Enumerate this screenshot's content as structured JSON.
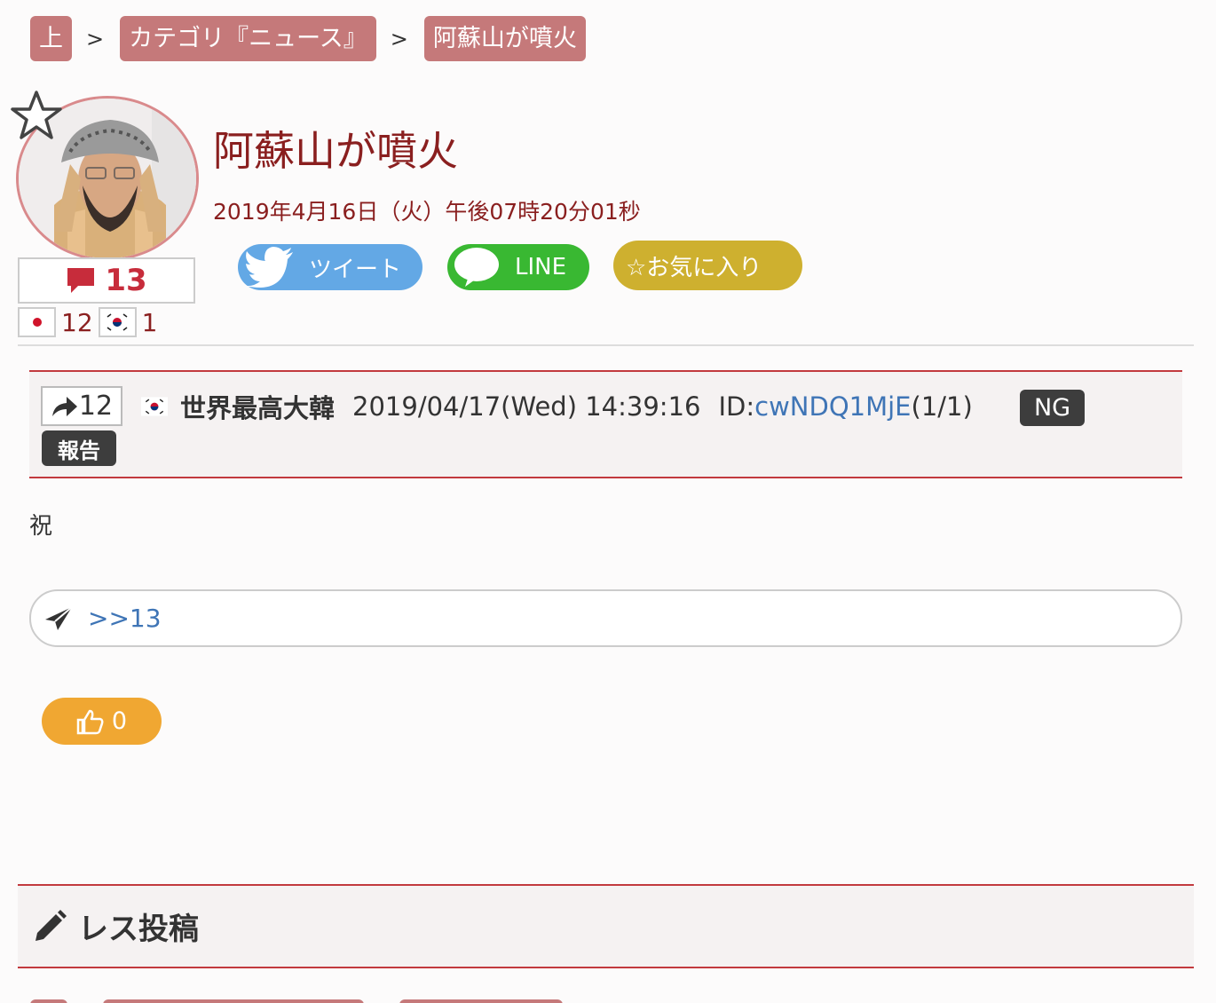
{
  "breadcrumb": {
    "items": [
      "上",
      "カテゴリ『ニュース』",
      "阿蘇山が噴火"
    ],
    "separator": ">"
  },
  "thread": {
    "title": "阿蘇山が噴火",
    "date": "2019年4月16日（火）午後07時20分01秒",
    "comment_count": "13",
    "flags": [
      {
        "country": "japan-flag-icon",
        "count": "12"
      },
      {
        "country": "korea-flag-icon",
        "count": "1"
      }
    ]
  },
  "share": {
    "tweet_label": "ツイート",
    "line_label": "LINE",
    "favorite_label": "☆お気に入り"
  },
  "post": {
    "res_count": "12",
    "author": "世界最高大韓",
    "datetime": "2019/04/17(Wed) 14:39:16",
    "id_label": "ID:",
    "id_value": "cwNDQ1MjE",
    "id_suffix": "(1/1)",
    "ng_label": "NG",
    "report_label": "報告",
    "body": "祝",
    "reply_anchor": ">>13",
    "like_count": "0"
  },
  "compose": {
    "heading": "レス投稿"
  },
  "colors": {
    "accent": "#8a1f1f",
    "crumb_bg": "#c5797a",
    "border_red": "#c23a3e",
    "twitter": "#63a8e5",
    "line": "#39b832",
    "favorite": "#ceb02f",
    "like": "#f0a732",
    "link": "#3f75b6"
  }
}
